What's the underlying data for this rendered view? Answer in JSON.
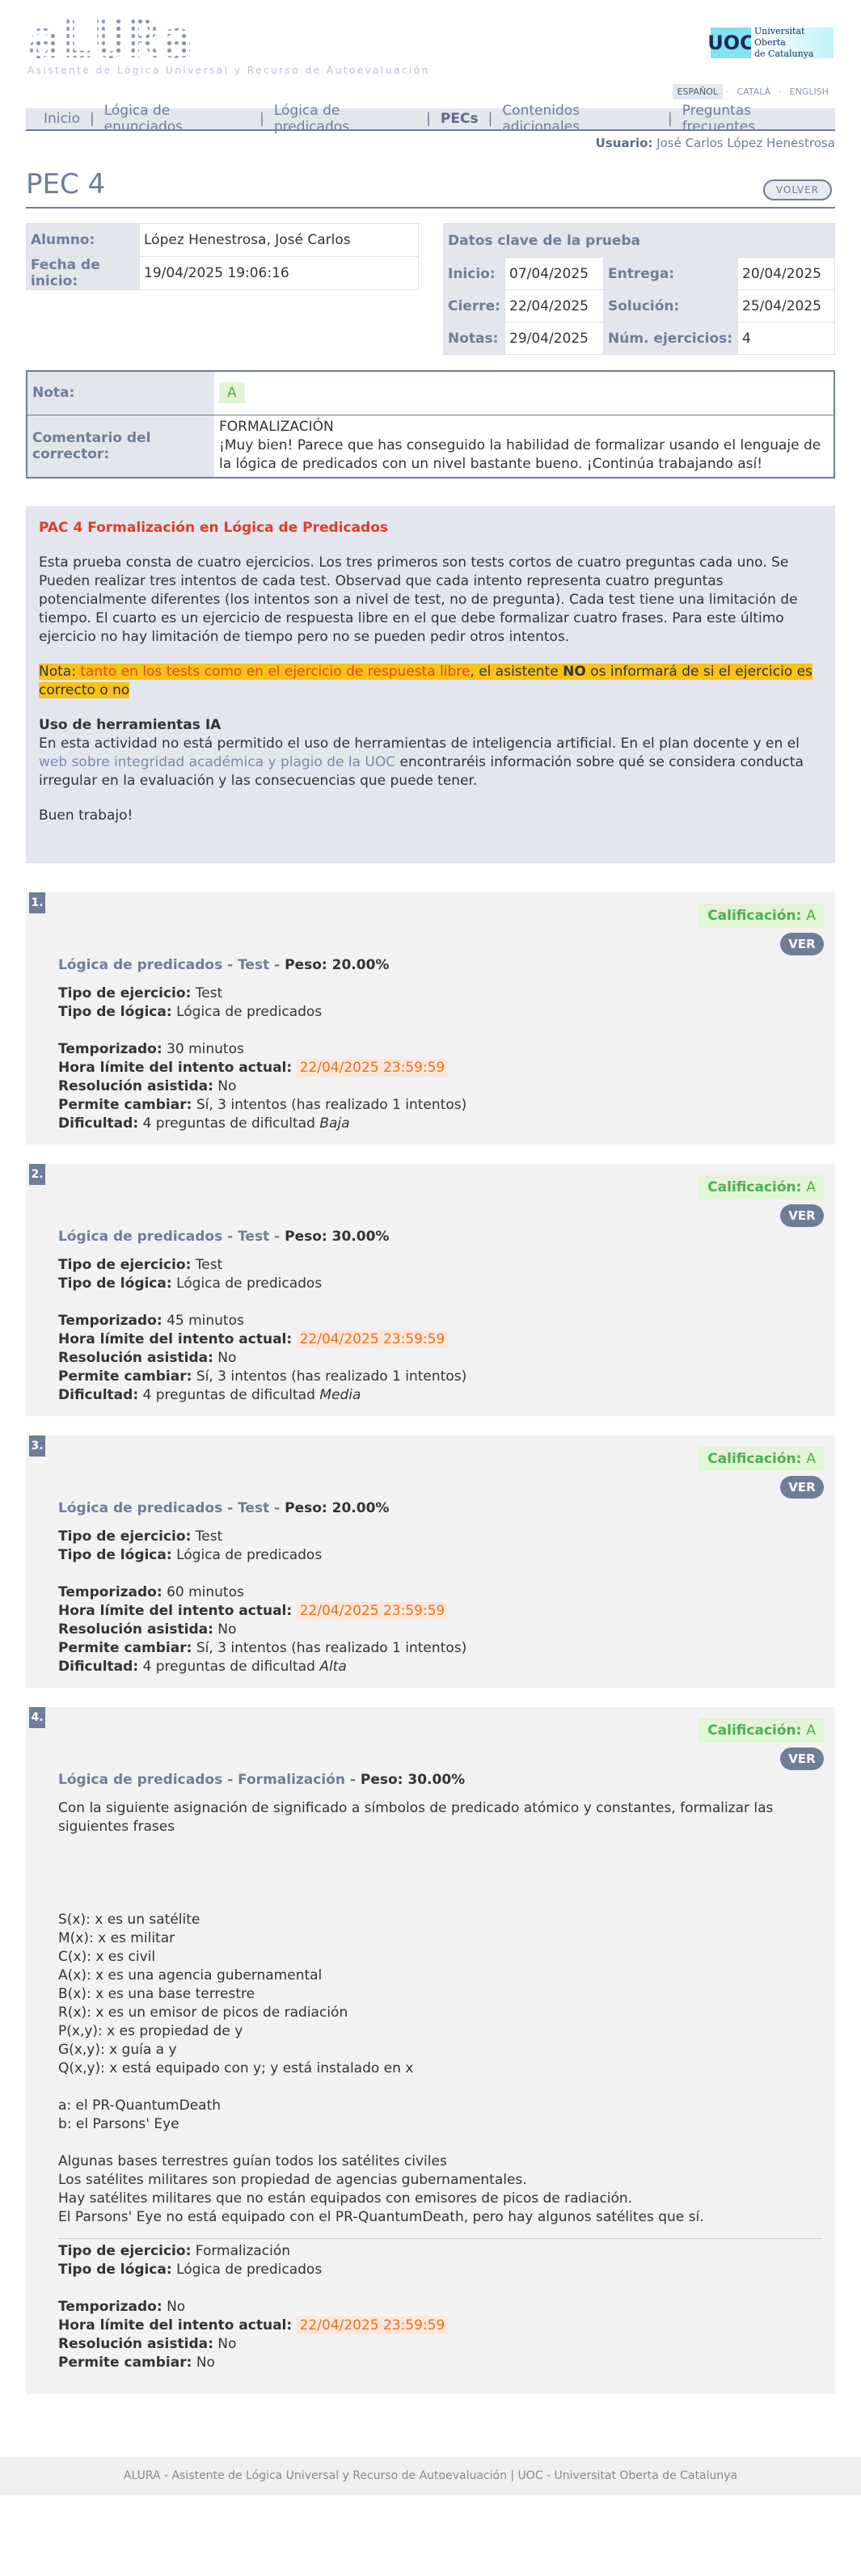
{
  "brand": {
    "logo_text": "aLURa",
    "logo_sub": "Asistente de Lógica Universal y Recurso de Autoevaluación",
    "uoc_mark": "UOC",
    "uoc_line1": "Universitat Oberta",
    "uoc_line2": "de Catalunya"
  },
  "languages": [
    "ESPAÑOL",
    "CATALÀ",
    "ENGLISH"
  ],
  "nav": [
    "Inicio",
    "Lógica de enunciados",
    "Lógica de predicados",
    "PECs",
    "Contenidos adicionales",
    "Preguntas frecuentes"
  ],
  "user": {
    "label": "Usuario:",
    "name": "José Carlos López Henestrosa"
  },
  "page": {
    "title": "PEC 4",
    "back_label": "VOLVER"
  },
  "student": {
    "alumno_label": "Alumno:",
    "alumno": "López Henestrosa, José Carlos",
    "inicio_label": "Fecha de inicio:",
    "inicio": "19/04/2025 19:06:16"
  },
  "datos": {
    "header": "Datos clave de la prueba",
    "inicio_label": "Inicio:",
    "inicio": "07/04/2025",
    "entrega_label": "Entrega:",
    "entrega": "20/04/2025",
    "cierre_label": "Cierre:",
    "cierre": "22/04/2025",
    "solucion_label": "Solución:",
    "solucion": "25/04/2025",
    "notas_label": "Notas:",
    "notas": "29/04/2025",
    "num_label": "Núm. ejercicios:",
    "num": "4"
  },
  "result": {
    "nota_label": "Nota:",
    "nota": "A",
    "comment_label": "Comentario del corrector:",
    "comment_line1": "FORMALIZACIÓN",
    "comment_line2": "¡Muy bien! Parece que has conseguido la habilidad de formalizar usando el lenguaje de la lógica de predicados con un nivel bastante bueno. ¡Continúa trabajando así!"
  },
  "intro": {
    "title": "PAC 4 Formalización en Lógica de Predicados",
    "p1": "Esta prueba consta de cuatro ejercicios. Los tres primeros son tests cortos de cuatro preguntas cada uno. Se Pueden realizar tres intentos de cada test. Observad que cada intento representa cuatro preguntas potencialmente diferentes (los intentos son a nivel de test, no de pregunta). Cada test tiene una limitación de tiempo. El cuarto es un ejercicio de respuesta libre en el que debe formalizar cuatro frases. Para este último ejercicio no hay limitación de tiempo pero no se pueden pedir otros intentos.",
    "note_a": "Nota: ",
    "note_b": "tanto en los tests como en el ejercicio de respuesta libre",
    "note_c": ", el asistente ",
    "note_d": "NO",
    "note_e": " os informará de si el ejercicio es correcto o no",
    "ia_title": "Uso de herramientas IA",
    "ia_a": "En esta actividad no está permitido el uso de herramientas de inteligencia artificial. En el plan docente y en el ",
    "ia_link": "web sobre integridad académica y plagio de la UOC",
    "ia_b": " encontraréis información sobre qué se considera conducta irregular en la evaluación y las consecuencias que puede tener.",
    "bye": "Buen trabajo!"
  },
  "labels": {
    "calificacion": "Calificación:",
    "ver": "VER",
    "peso": "Peso:",
    "tipo_ej": "Tipo de ejercicio:",
    "tipo_log": "Tipo de lógica:",
    "temporizado": "Temporizado:",
    "hora": "Hora límite del intento actual:",
    "resolucion": "Resolución asistida:",
    "cambiar": "Permite cambiar:",
    "dificultad": "Dificultad:"
  },
  "exercises": [
    {
      "num": "1.",
      "grade": "A",
      "name": "Lógica de predicados - Test",
      "peso": "20.00%",
      "tipo": "Test",
      "logica": "Lógica de predicados",
      "tiempo": "30 minutos",
      "hora": "22/04/2025 23:59:59",
      "asistida": "No",
      "cambiar": "Sí, 3 intentos (has realizado 1 intentos)",
      "dif_a": "4 preguntas de dificultad ",
      "dif_b": "Baja"
    },
    {
      "num": "2.",
      "grade": "A",
      "name": "Lógica de predicados - Test",
      "peso": "30.00%",
      "tipo": "Test",
      "logica": "Lógica de predicados",
      "tiempo": "45 minutos",
      "hora": "22/04/2025 23:59:59",
      "asistida": "No",
      "cambiar": "Sí, 3 intentos (has realizado 1 intentos)",
      "dif_a": "4 preguntas de dificultad ",
      "dif_b": "Media"
    },
    {
      "num": "3.",
      "grade": "A",
      "name": "Lógica de predicados - Test",
      "peso": "20.00%",
      "tipo": "Test",
      "logica": "Lógica de predicados",
      "tiempo": "60 minutos",
      "hora": "22/04/2025 23:59:59",
      "asistida": "No",
      "cambiar": "Sí, 3 intentos (has realizado 1 intentos)",
      "dif_a": "4 preguntas de dificultad ",
      "dif_b": "Alta"
    },
    {
      "num": "4.",
      "grade": "A",
      "name": "Lógica de predicados - Formalización",
      "peso": "30.00%",
      "tipo": "Formalización",
      "logica": "Lógica de predicados",
      "tiempo": "No",
      "hora": "22/04/2025 23:59:59",
      "asistida": "No",
      "cambiar": "No",
      "statement": "Con la siguiente asignación de significado a símbolos de predicado atómico y constantes, formalizar las siguientes frases",
      "predicates": [
        "S(x): x es un satélite",
        "M(x): x es militar",
        "C(x): x es civil",
        "A(x): x es una agencia gubernamental",
        "B(x): x es una base terrestre",
        "R(x): x es un emisor de picos de radiación",
        "P(x,y): x es propiedad de y",
        "G(x,y): x guía a y",
        "Q(x,y): x está equipado con y; y está instalado en x"
      ],
      "constants": [
        "a: el PR-QuantumDeath",
        "b: el Parsons' Eye"
      ],
      "sentences": [
        "Algunas bases terrestres guían todos los satélites civiles",
        "Los satélites militares son propiedad de agencias gubernamentales.",
        "Hay satélites militares que no están equipados con emisores de picos de radiación.",
        "El Parsons' Eye no está equipado con el PR-QuantumDeath, pero hay algunos satélites que sí."
      ]
    }
  ],
  "footer": "ALURA - Asistente de Lógica Universal y Recurso de Autoevaluación | UOC - Universitat Oberta de Catalunya",
  "colors": {
    "accent": "#6f7d99",
    "panel": "#e3e6ed",
    "grade_bg": "#e2f4d6",
    "grade_text": "#4caf50",
    "alert_red": "#e03b2b",
    "highlight": "#f8c21a"
  }
}
